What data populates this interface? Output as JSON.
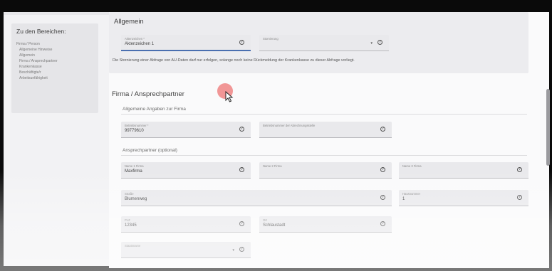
{
  "sidebar": {
    "title": "Zu den Bereichen:",
    "items": [
      {
        "label": "Firma / Person"
      },
      {
        "label": "Allgemeine Hinweise"
      },
      {
        "label": "Allgemein"
      },
      {
        "label": "Firma / Ansprechpartner"
      },
      {
        "label": "Krankenkasse"
      },
      {
        "label": "Beschäftigte/r"
      },
      {
        "label": "Arbeitsunfähigkeit"
      }
    ]
  },
  "allgemein": {
    "title": "Allgemein",
    "aktenzeichen": {
      "label": "Aktenzeichen *",
      "value": "Aktenzeichen 1"
    },
    "stornierung": {
      "label": "Stornierung",
      "value": ""
    },
    "info": "Die Stornierung einer Abfrage von AU-Daten darf nur erfolgen, solange noch keine Rückmeldung der Krankenkasse zu dieser Abfrage vorliegt."
  },
  "firma": {
    "title": "Firma / Ansprechpartner",
    "angaben_heading": "Allgemeine Angaben zur Firma",
    "betriebsnummer": {
      "label": "Betriebsnummer *",
      "value": "99779610"
    },
    "betriebsnummer_abrechnung": {
      "label": "Betriebsnummer der Abrechnungsstelle",
      "value": ""
    },
    "ansprechpartner_heading": "Ansprechpartner (optional)",
    "name1": {
      "label": "Name 1 Firma",
      "value": "Maxfirma"
    },
    "name2": {
      "label": "Name 2 Firma",
      "value": ""
    },
    "name3": {
      "label": "Name 3 Firma",
      "value": ""
    },
    "strasse": {
      "label": "Straße",
      "value": "Blumenweg"
    },
    "hausnummer": {
      "label": "Hausnummer",
      "value": "1"
    },
    "plz": {
      "label": "PLZ",
      "value": "12345"
    },
    "ort": {
      "label": "Ort",
      "value": "Schlaustadt"
    },
    "staatsname": {
      "label": "Staatsname",
      "value": ""
    }
  },
  "icons": {
    "help": "help-circle-icon",
    "dropdown": "chevron-down-icon",
    "cursor": "mouse-pointer-icon"
  },
  "colors": {
    "accent": "#4a6fb0",
    "highlight": "#ef8b8b"
  }
}
